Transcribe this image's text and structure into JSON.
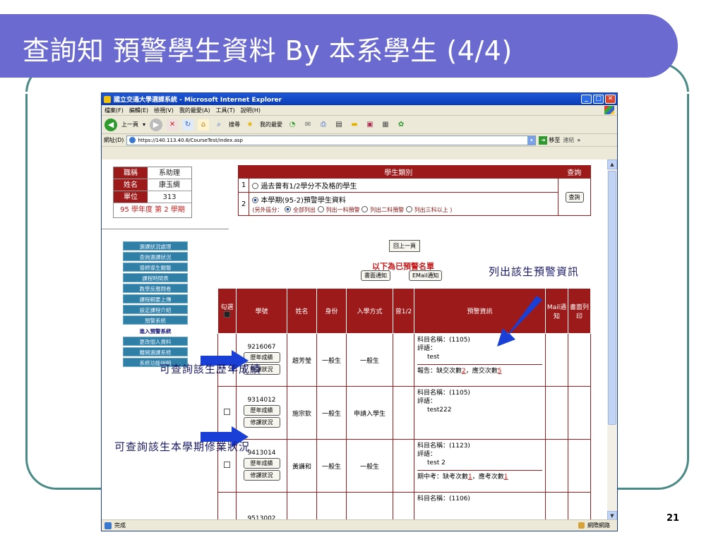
{
  "slide": {
    "title": "查詢知 預警學生資料 By 本系學生  (4/4)",
    "page_number": "21",
    "colors": {
      "banner": "#6a6ad0",
      "frame": "#4a8a86"
    }
  },
  "browser": {
    "title": "國立交通大學選課系統 - Microsoft Internet Explorer",
    "menu": [
      "檔案(F)",
      "編輯(E)",
      "檢視(V)",
      "我的最愛(A)",
      "工具(T)",
      "說明(H)"
    ],
    "toolbar": {
      "back": "上一頁",
      "search": "搜尋",
      "favorites": "我的最愛"
    },
    "address_label": "網址(D)",
    "url": "https://140.113.40.8/CourseTest/index.asp",
    "go_label": "移至",
    "links_label": "連結",
    "status_text": "完成",
    "zone_text": "網際網路"
  },
  "user_info": {
    "rows": [
      {
        "key": "職稱",
        "value": "系助理"
      },
      {
        "key": "姓名",
        "value": "康玉綢"
      },
      {
        "key": "單位",
        "value": "313"
      }
    ],
    "term": "95 學年度 第 2 學期"
  },
  "nav_menu": [
    "選課狀況處理",
    "查詢選課狀況",
    "導師導生關聯",
    "課程時間表",
    "教學反應問卷",
    "課程綱要上傳",
    "設定課程介紹",
    "預警系統",
    "進入預警系統",
    "更改個人資料",
    "離開選課系統",
    "系統功能說明"
  ],
  "category": {
    "header": "學生類別",
    "query_header": "查詢",
    "option1_num": "1",
    "option1": "過去曾有1/2學分不及格的學生",
    "option2_num": "2",
    "option2": "本學期(95-2)預警學生資料",
    "sub_prefix": "(另外區分：",
    "sub_options": [
      "全部列出",
      "列出一科預警",
      "列出二科預警",
      "列出三科以上"
    ],
    "sub_suffix": ")",
    "query_button": "查詢"
  },
  "back_button": "回上一頁",
  "warning_heading": "以下為已預警名單",
  "screen_notify": "書面通知",
  "email_notify": "EMail通知",
  "annotations": {
    "warning_info": "列出該生預警資訊",
    "grades": "可查詢該生歷年成績",
    "enrollment": "可查詢該生本學期修業狀況"
  },
  "table": {
    "headers": [
      "勾選",
      "學號",
      "姓名",
      "身份",
      "入學方式",
      "曾1/2",
      "預警資訊",
      "Mail通知",
      "書面列印"
    ],
    "grades_btn": "歷年成績",
    "status_btn": "修課狀況",
    "rows": [
      {
        "id": "9216067",
        "name": "趙芳瑩",
        "status": "一般生",
        "admission": "一般生",
        "course": "科目名稱：(1105)",
        "comment_label": "評語：",
        "comment": "test",
        "report": "報告：缺交次數",
        "r1": "2",
        "r_mid": "，應交次數",
        "r2": "5"
      },
      {
        "id": "9314012",
        "name": "施宗欽",
        "status": "一般生",
        "admission": "申請入學生",
        "course": "科目名稱：(1105)",
        "comment_label": "評語：",
        "comment": "test222",
        "report": "",
        "r1": "",
        "r_mid": "",
        "r2": ""
      },
      {
        "id": "9413014",
        "name": "黃謙和",
        "status": "一般生",
        "admission": "一般生",
        "course": "科目名稱：(1123)",
        "comment_label": "評語：",
        "comment": "test 2",
        "report": "期中考：缺考次數",
        "r1": "1",
        "r_mid": "，應考次數",
        "r2": "1"
      },
      {
        "id": "9513002",
        "name": "",
        "status": "",
        "admission": "",
        "course": "科目名稱：(1106)",
        "comment_label": "",
        "comment": "",
        "report": "",
        "r1": "",
        "r_mid": "",
        "r2": ""
      }
    ]
  }
}
